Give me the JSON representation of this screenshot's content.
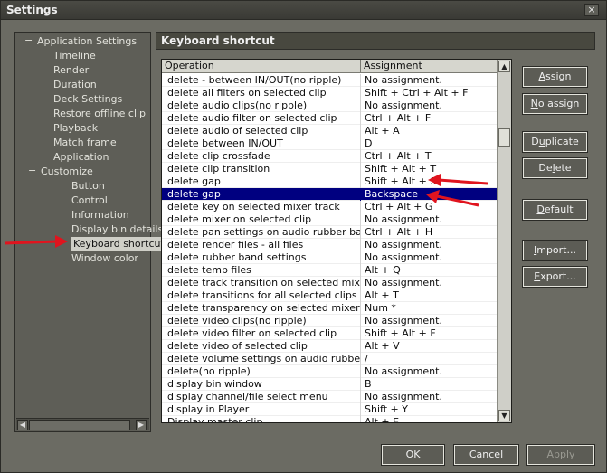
{
  "window": {
    "title": "Settings",
    "close_glyph": "×"
  },
  "tree": {
    "items": [
      {
        "label": "Application Settings",
        "expander": "−"
      },
      {
        "label": "Timeline"
      },
      {
        "label": "Render"
      },
      {
        "label": "Duration"
      },
      {
        "label": "Deck Settings"
      },
      {
        "label": "Restore offline clip"
      },
      {
        "label": "Playback"
      },
      {
        "label": "Match frame"
      },
      {
        "label": "Application"
      },
      {
        "label": "Customize",
        "expander": "−"
      },
      {
        "label": "Button"
      },
      {
        "label": "Control"
      },
      {
        "label": "Information"
      },
      {
        "label": "Display bin details"
      },
      {
        "label": "Keyboard shortcut",
        "selected": true
      },
      {
        "label": "Window color"
      }
    ]
  },
  "panel": {
    "title": "Keyboard shortcut"
  },
  "table": {
    "columns": [
      "Operation",
      "Assignment"
    ],
    "rows": [
      [
        "delete - between IN/OUT(no ripple)",
        "No assignment."
      ],
      [
        "delete all filters on selected clip",
        "Shift + Ctrl + Alt + F"
      ],
      [
        "delete audio clips(no ripple)",
        "No assignment."
      ],
      [
        "delete audio filter on selected clip",
        "Ctrl + Alt + F"
      ],
      [
        "delete audio of selected clip",
        "Alt + A"
      ],
      [
        "delete between IN/OUT",
        "D"
      ],
      [
        "delete clip crossfade",
        "Ctrl + Alt + T"
      ],
      [
        "delete clip transition",
        "Shift + Alt + T"
      ],
      [
        "delete gap",
        "Shift + Alt + S"
      ],
      [
        "delete gap",
        "Backspace"
      ],
      [
        "delete key on selected mixer track",
        "Ctrl + Alt + G"
      ],
      [
        "delete mixer on selected clip",
        "No assignment."
      ],
      [
        "delete pan settings on audio rubber band",
        "Ctrl + Alt + H"
      ],
      [
        "delete render files - all files",
        "No assignment."
      ],
      [
        "delete rubber band settings",
        "No assignment."
      ],
      [
        "delete temp files",
        "Alt + Q"
      ],
      [
        "delete track transition on selected mixer ...",
        "No assignment."
      ],
      [
        "delete transitions for all selected clips",
        "Alt + T"
      ],
      [
        "delete transparency on selected mixer tr...",
        "Num *"
      ],
      [
        "delete video clips(no ripple)",
        "No assignment."
      ],
      [
        "delete video filter on selected clip",
        "Shift + Alt + F"
      ],
      [
        "delete video of selected clip",
        "Alt + V"
      ],
      [
        "delete volume settings on audio rubber b...",
        "/"
      ],
      [
        "delete(no ripple)",
        "No assignment."
      ],
      [
        "display bin window",
        "B"
      ],
      [
        "display channel/file select menu",
        "No assignment."
      ],
      [
        "display in Player",
        "Shift + Y"
      ],
      [
        "Display master clip",
        "Alt + E"
      ]
    ],
    "selected_row": 9
  },
  "buttons": {
    "assign": {
      "pre": "",
      "u": "A",
      "post": "ssign"
    },
    "no_assign": {
      "pre": "",
      "u": "N",
      "post": "o assign"
    },
    "duplicate": {
      "pre": "D",
      "u": "u",
      "post": "plicate"
    },
    "delete": {
      "pre": "De",
      "u": "l",
      "post": "ete"
    },
    "default": {
      "pre": "",
      "u": "D",
      "post": "efault"
    },
    "import": {
      "pre": "",
      "u": "I",
      "post": "mport..."
    },
    "export": {
      "pre": "",
      "u": "E",
      "post": "xport..."
    },
    "ok": "OK",
    "cancel": "Cancel",
    "apply": "Apply"
  },
  "colors": {
    "selection": "#000080",
    "annotation_arrow": "#e0141e"
  }
}
